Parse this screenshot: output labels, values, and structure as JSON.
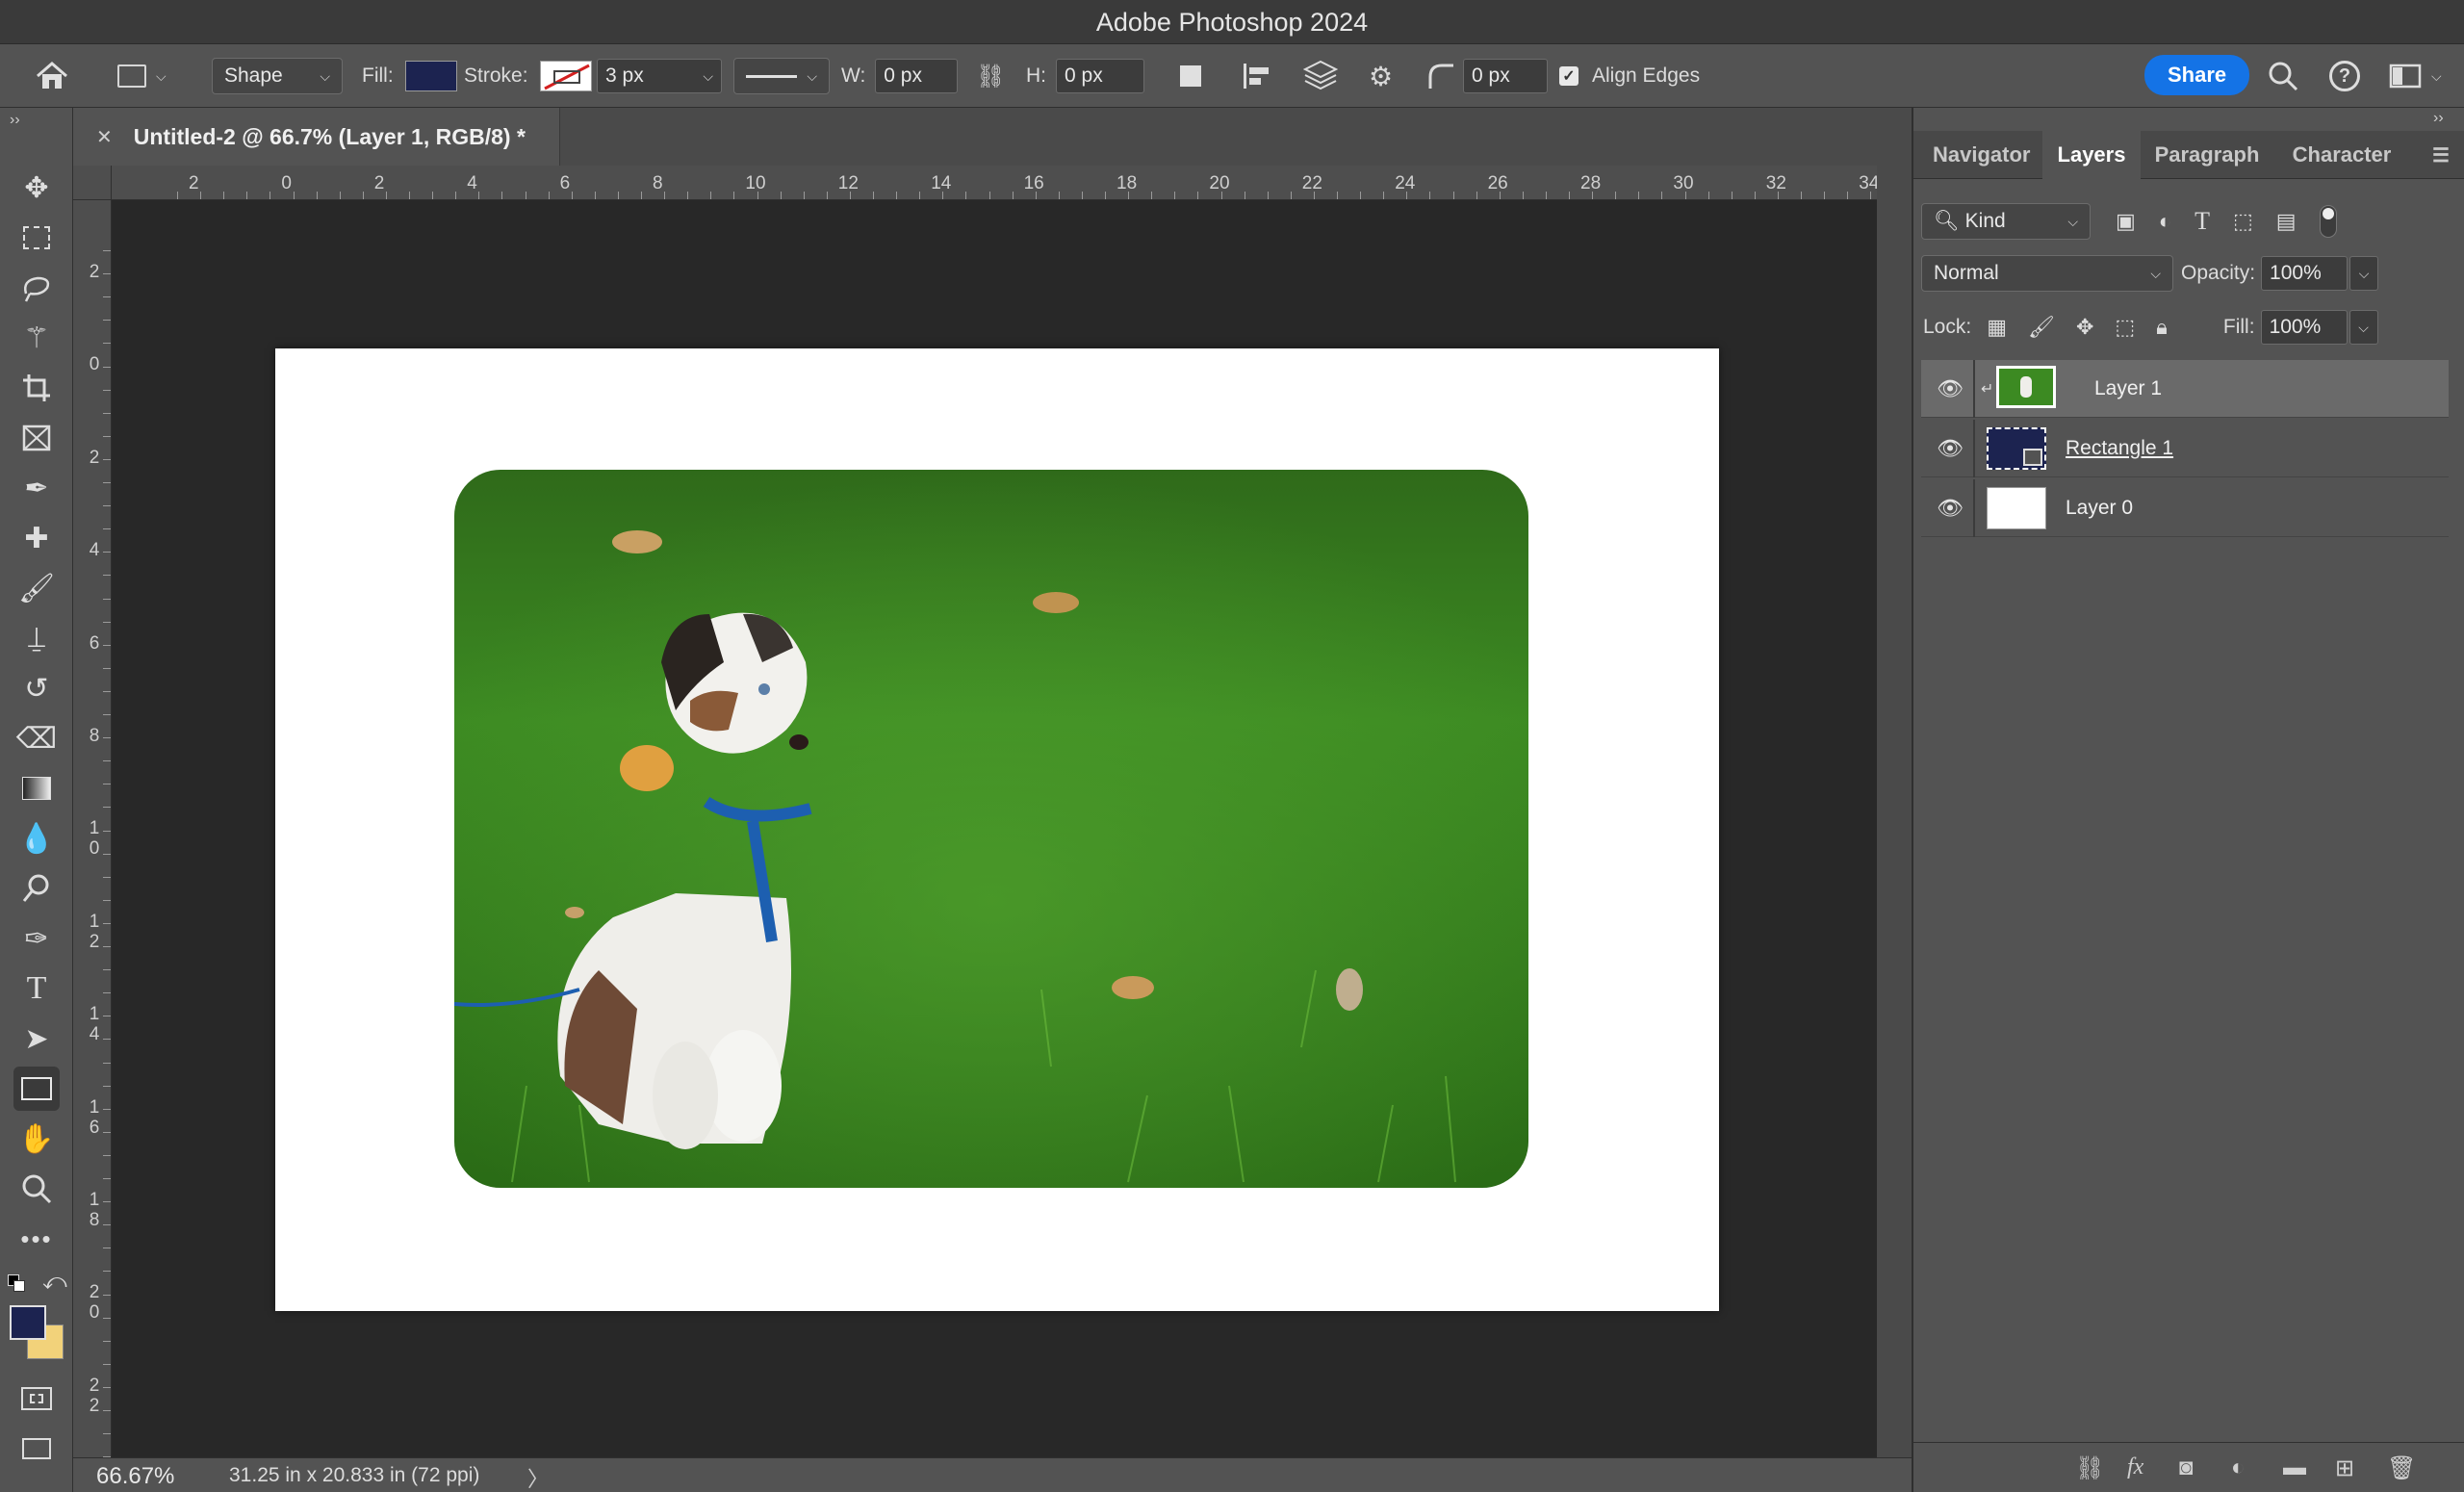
{
  "window": {
    "title": "Adobe Photoshop 2024"
  },
  "options_bar": {
    "mode_label": "Shape",
    "fill_label": "Fill:",
    "fill_color": "#1c2350",
    "stroke_label": "Stroke:",
    "stroke_width": "3 px",
    "w_label": "W:",
    "w_value": "0 px",
    "h_label": "H:",
    "h_value": "0 px",
    "radius_value": "0 px",
    "align_edges_label": "Align Edges",
    "align_edges_checked": true,
    "share_label": "Share"
  },
  "toolbar": {
    "tools": [
      "move",
      "marquee",
      "lasso",
      "magic-wand",
      "crop",
      "frame",
      "eyedropper",
      "healing",
      "brush",
      "stamp",
      "history-brush",
      "eraser",
      "gradient",
      "blur",
      "dodge",
      "pen",
      "type",
      "path-select",
      "rectangle",
      "hand",
      "zoom",
      "more"
    ],
    "foreground_color": "#1c2350",
    "background_color": "#f2d27a"
  },
  "document": {
    "tab_title": "Untitled-2 @ 66.7% (Layer 1, RGB/8) *",
    "h_ruler": [
      "2",
      "0",
      "2",
      "4",
      "6",
      "8",
      "10",
      "12",
      "14",
      "16",
      "18",
      "20",
      "22",
      "24",
      "26",
      "28",
      "30",
      "32",
      "34"
    ],
    "v_ruler": [
      "2",
      "0",
      "2",
      "4",
      "6",
      "8",
      "10",
      "12",
      "14",
      "16",
      "18",
      "20",
      "22"
    ]
  },
  "status": {
    "zoom": "66.67%",
    "doc_info": "31.25 in x 20.833 in (72 ppi)",
    "arrow": "〉"
  },
  "panel": {
    "tabs": [
      "Navigator",
      "Layers",
      "Paragraph",
      "Character"
    ],
    "active_tab": "Layers",
    "filter_label": "Kind",
    "blend_mode": "Normal",
    "opacity_label": "Opacity:",
    "opacity_value": "100%",
    "lock_label": "Lock:",
    "fill_label": "Fill:",
    "fill_value": "100%",
    "layers": [
      {
        "name": "Layer 1",
        "selected": true,
        "clipped": true
      },
      {
        "name": "Rectangle 1",
        "selected": false,
        "clipped": false
      },
      {
        "name": "Layer 0",
        "selected": false,
        "clipped": false
      }
    ]
  }
}
